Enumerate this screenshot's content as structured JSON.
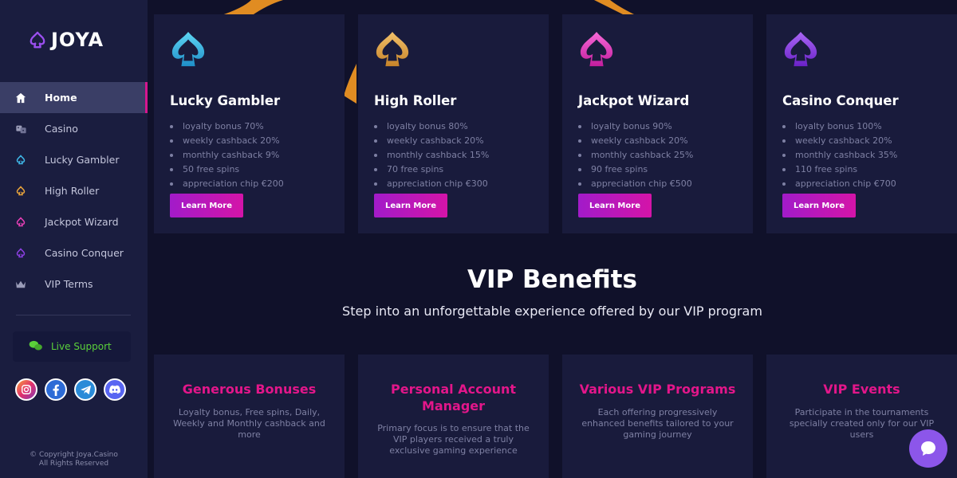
{
  "brand": {
    "name": "JOYA"
  },
  "sidebar": {
    "items": [
      {
        "label": "Home",
        "icon": "home-icon",
        "active": true
      },
      {
        "label": "Casino",
        "icon": "dice-icon"
      },
      {
        "label": "Lucky Gambler",
        "icon": "spade-icon",
        "color": "#3fb6e6"
      },
      {
        "label": "High Roller",
        "icon": "spade-icon",
        "color": "#e7a33b"
      },
      {
        "label": "Jackpot Wizard",
        "icon": "spade-icon",
        "color": "#e43fb4"
      },
      {
        "label": "Casino Conquer",
        "icon": "spade-icon",
        "color": "#8a3fe0"
      },
      {
        "label": "VIP Terms",
        "icon": "crown-icon"
      }
    ],
    "support_label": "Live Support",
    "socials": [
      "instagram-icon",
      "facebook-icon",
      "telegram-icon",
      "discord-icon"
    ],
    "copyright_line1": "© Copyright Joya.Casino",
    "copyright_line2": "All Rights Reserved"
  },
  "tiers": [
    {
      "title": "Lucky Gambler",
      "color_top": "#5fd6f3",
      "color_bottom": "#1f8fc9",
      "perks": [
        "loyalty bonus 70%",
        "weekly cashback 20%",
        "monthly cashback 9%",
        "50 free spins",
        "appreciation chip €200"
      ],
      "button": "Learn More"
    },
    {
      "title": "High Roller",
      "color_top": "#f1c06a",
      "color_bottom": "#c7842a",
      "perks": [
        "loyalty bonus 80%",
        "weekly cashback 20%",
        "monthly cashback 15%",
        "70 free spins",
        "appreciation chip €300"
      ],
      "button": "Learn More"
    },
    {
      "title": "Jackpot Wizard",
      "color_top": "#f76ad8",
      "color_bottom": "#c21d9d",
      "perks": [
        "loyalty bonus 90%",
        "weekly cashback 20%",
        "monthly cashback 25%",
        "90 free spins",
        "appreciation chip €500"
      ],
      "button": "Learn More"
    },
    {
      "title": "Casino Conquer",
      "color_top": "#a966f4",
      "color_bottom": "#6a22c7",
      "perks": [
        "loyalty bonus 100%",
        "weekly cashback 20%",
        "monthly cashback 35%",
        "110 free spins",
        "appreciation chip €700"
      ],
      "button": "Learn More"
    }
  ],
  "vip": {
    "title": "VIP Benefits",
    "subtitle": "Step into an unforgettable experience offered by our VIP program"
  },
  "benefits": [
    {
      "title": "Generous Bonuses",
      "text": "Loyalty bonus, Free spins, Daily, Weekly and Monthly cashback and more"
    },
    {
      "title": "Personal Account Manager",
      "text": "Primary focus is to ensure that the VIP players received a truly exclusive gaming experience"
    },
    {
      "title": "Various VIP Programs",
      "text": "Each offering progressively enhanced benefits tailored to your gaming journey"
    },
    {
      "title": "VIP Events",
      "text": "Participate in the tournaments specially created only for our VIP users"
    }
  ],
  "colors": {
    "accent": "#d5168f",
    "sidebar_bg": "#1a1d3f",
    "card_bg": "#191b3c",
    "benefit_title": "#e3168a",
    "support_green": "#5bd03a"
  }
}
